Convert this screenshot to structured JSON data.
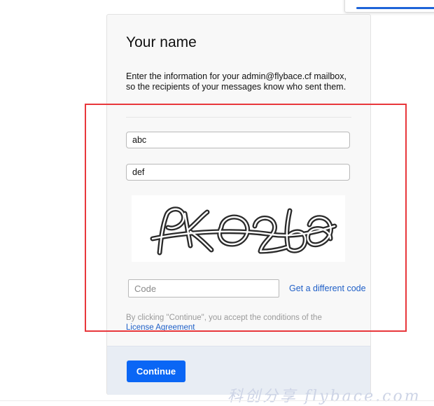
{
  "form": {
    "title": "Your name",
    "description": "Enter the information for your admin@flybace.cf mailbox, so the recipients of your messages know who sent them.",
    "first_name_value": "abc",
    "last_name_value": "def",
    "captcha_text": "pK02b6",
    "code_placeholder": "Code",
    "new_code_label": "Get a different code",
    "agreement_prefix": "By clicking \"Continue\", you accept the conditions of the",
    "agreement_link": "License Agreement",
    "continue_label": "Continue"
  },
  "watermark": "科创分享 flybace.com",
  "colors": {
    "accent": "#0a66f5",
    "link": "#1f5fc7",
    "highlight": "#e8373b",
    "footer_bg": "#e8edf4"
  }
}
